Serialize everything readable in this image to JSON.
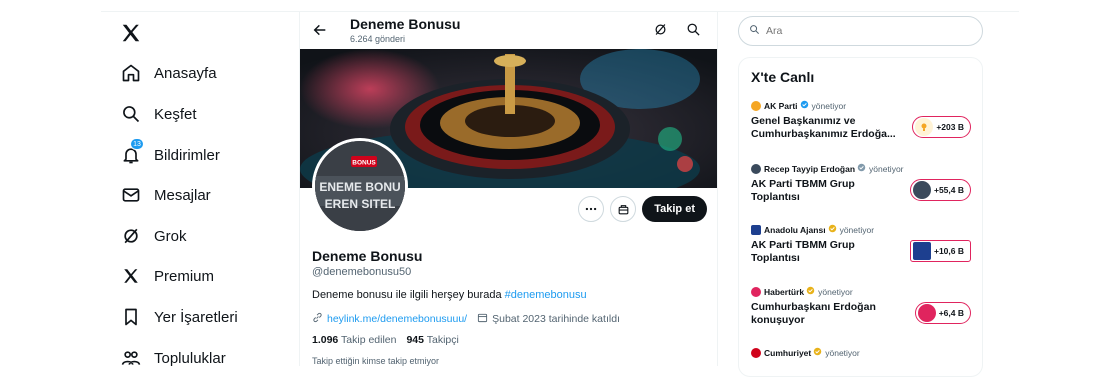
{
  "nav": {
    "items": [
      {
        "label": "Anasayfa",
        "icon": "home-icon"
      },
      {
        "label": "Keşfet",
        "icon": "search-icon"
      },
      {
        "label": "Bildirimler",
        "icon": "bell-icon",
        "badge": "13"
      },
      {
        "label": "Mesajlar",
        "icon": "mail-icon"
      },
      {
        "label": "Grok",
        "icon": "grok-icon"
      },
      {
        "label": "Premium",
        "icon": "x-premium-icon"
      },
      {
        "label": "Yer İşaretleri",
        "icon": "bookmark-icon"
      },
      {
        "label": "Topluluklar",
        "icon": "communities-icon"
      }
    ]
  },
  "header": {
    "title": "Deneme Bonusu",
    "subtitle": "6.264 gönderi"
  },
  "profile": {
    "avatar_text_1": "BONUS",
    "avatar_text_2": "ENEME BONU",
    "avatar_text_3": "EREN SITEL",
    "name": "Deneme Bonusu",
    "handle": "@denemebonusu50",
    "bio_text": "Deneme bonusu ile ilgili herşey burada ",
    "bio_tag": "#denemebonusu",
    "link": "heylink.me/denemebonusuuu/",
    "joined": "Şubat 2023 tarihinde katıldı",
    "following_count": "1.096",
    "following_label": "Takip edilen",
    "followers_count": "945",
    "followers_label": "Takipçi",
    "note": "Takip ettiğin kimse takip etmiyor",
    "follow_label": "Takip et"
  },
  "search": {
    "placeholder": "Ara"
  },
  "trends": {
    "title": "X'te Canlı",
    "managing_label": "yönetiyor",
    "items": [
      {
        "source": "AK Parti",
        "topic": "Genel Başkanımız ve Cumhurbaşkanımız Erdoğa...",
        "count": "+203 B",
        "color": "#f5a623"
      },
      {
        "source": "Recep Tayyip Erdoğan",
        "topic": "AK Parti TBMM Grup Toplantısı",
        "count": "+55,4 B",
        "color": "#3a4a5c"
      },
      {
        "source": "Anadolu Ajansı",
        "topic": "AK Parti TBMM Grup Toplantısı",
        "count": "+10,6 B",
        "color": "#1d3f8f"
      },
      {
        "source": "Habertürk",
        "topic": "Cumhurbaşkanı Erdoğan konuşuyor",
        "count": "+6,4 B",
        "color": "#e0245e"
      },
      {
        "source": "Cumhuriyet",
        "topic": "",
        "count": "",
        "color": "#d0021b"
      }
    ]
  },
  "colors": {
    "accent": "#1d9bf0",
    "pill_border": "#e0245e",
    "dark": "#0f1419"
  }
}
